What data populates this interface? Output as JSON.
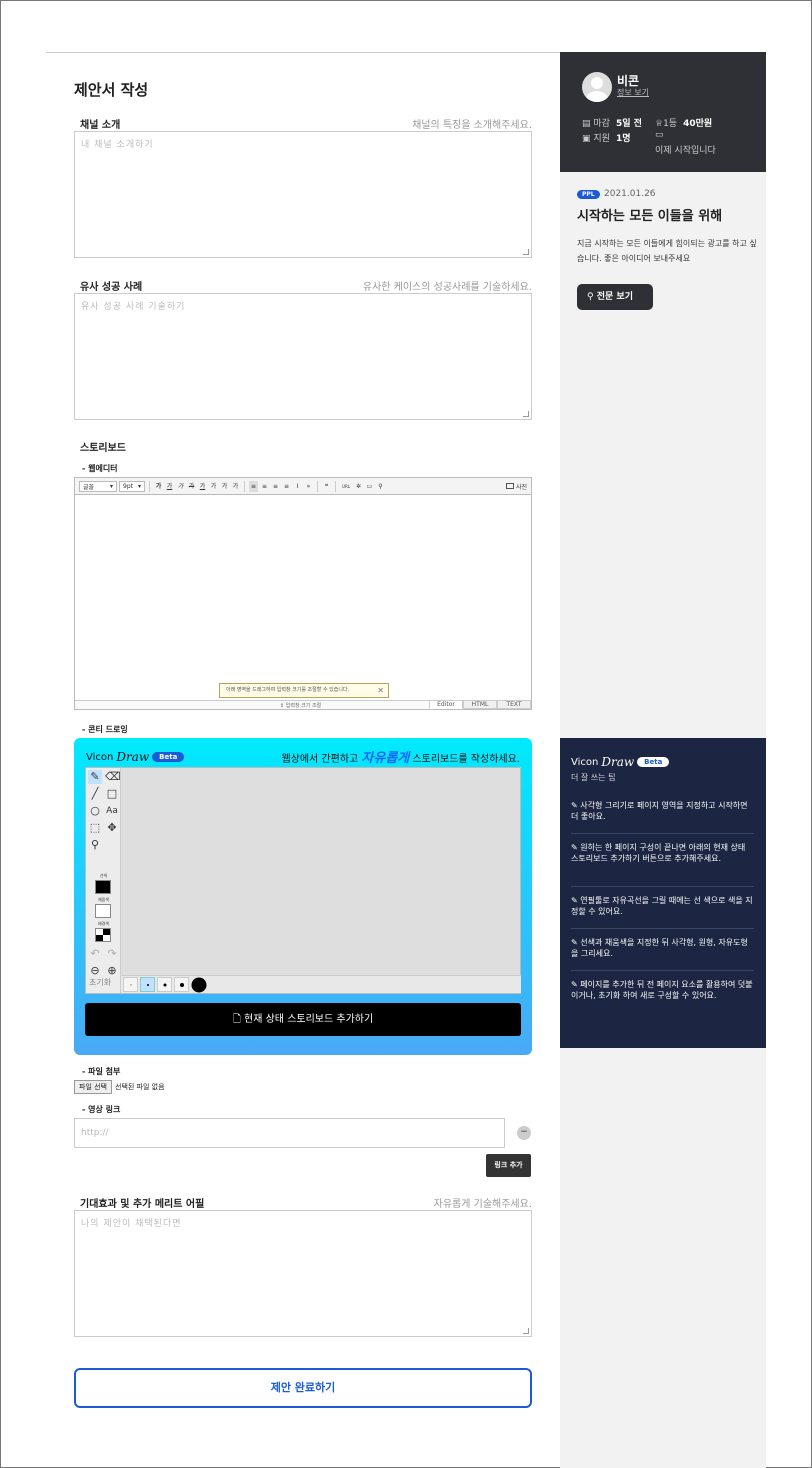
{
  "form": {
    "title": "제안서 작성",
    "channel": {
      "label": "채널 소개",
      "hint": "채널의 특징을 소개해주세요.",
      "placeholder": "내 채널 소개하기"
    },
    "cases": {
      "label": "유사 성공 사례",
      "hint": "유사한 케이스의 성공사례를 기술하세요.",
      "placeholder": "유사 성공 사례 기술하기"
    },
    "storyboard": {
      "label": "스토리보드",
      "web_editor_label": "- 웹에디터",
      "draw_label": "- 콘티 드로잉"
    },
    "editor": {
      "font_select": "글꼴",
      "size_select": "9pt",
      "buttons": [
        "가",
        "가",
        "가",
        "가",
        "가",
        "가",
        "가",
        "가",
        "가",
        "≡",
        "≡",
        "≡",
        "≡",
        "I",
        "»",
        "❝",
        "URL",
        "✲",
        "▭",
        "⚲"
      ],
      "photo_label": "사진",
      "resize_hint": "아래 영역을 드래그하여 입력창 크기를 조절할 수 있습니다.",
      "resize_label": "⇕ 입력창 크기 조절",
      "tabs": [
        "Editor",
        "HTML",
        "TEXT"
      ],
      "active_tab": "Editor"
    },
    "draw": {
      "logo": "Vicon",
      "logo_script": "Draw",
      "beta": "Beta",
      "tagline_pre": "웹상에서 간편하고 ",
      "tagline_em": "자유롭게",
      "tagline_post": " 스토리보드를 작성하세요.",
      "stroke_label": "선색",
      "fill_label": "채움색",
      "bg_label": "배경색",
      "reset": "초기화",
      "stroke_color": "#000000",
      "fill_color": "#ffffff",
      "brush_selected_index": 1,
      "add_button": "현재 상태 스토리보드 추가하기"
    },
    "file": {
      "label": "- 파일 첨부",
      "button": "파일 선택",
      "status": "선택된 파일 없음"
    },
    "video": {
      "label": "- 영상 링크",
      "placeholder": "http://",
      "remove": "−",
      "add_button": "링크 추가"
    },
    "merit": {
      "label": "기대효과 및 추가 메리트 어필",
      "hint": "자유롭게 기술해주세요.",
      "placeholder": "나의 제안이 채택된다면"
    },
    "submit": "제안 완료하기"
  },
  "sidebar": {
    "user": {
      "name": "비콘",
      "info_link": "정보 보기"
    },
    "stats": {
      "deadline_label": "마감",
      "deadline_value": "5일 전",
      "applicants_label": "지원",
      "applicants_value": "1명",
      "prize_label": "1등",
      "prize_value": "40만원",
      "status": "이제 시작입니다"
    },
    "post": {
      "badge": "PPL",
      "date": "2021.01.26",
      "title": "시작하는 모든 이들을 위해",
      "desc": "지금 시작하는 모든 이들에게 힘이되는 광고를 하고 싶습니다. 좋은 아이디어 보내주세요",
      "full_button": "전문 보기"
    },
    "tips": {
      "logo": "Vicon",
      "logo_script": "Draw",
      "beta": "Beta",
      "subtitle": "더 잘 쓰는 팁",
      "items": [
        "사각형 그리기로 페이지 영역을 지정하고 시작하면 더 좋아요.",
        "원하는 한 페이지 구성이 끝나면 아래의 현재 상태 스토리보드 추가하기 버튼으로 추가해주세요.",
        "연필툴로 자유곡선을 그릴 때에는 선 색으로 색을 지정할 수 있어요.",
        "선색과 채움색을 지정한 뒤 사각형, 원형, 자유도형을 그리세요.",
        "페이지를 추가한 뒤 전 페이지 요소를 활용하여 덧붙이거나, 초기화 하여 새로 구성할 수 있어요."
      ]
    }
  },
  "colors": {
    "accent": "#1b5bd8",
    "sidebar_dark": "#2e3035",
    "tips_bg": "#1c2541"
  }
}
